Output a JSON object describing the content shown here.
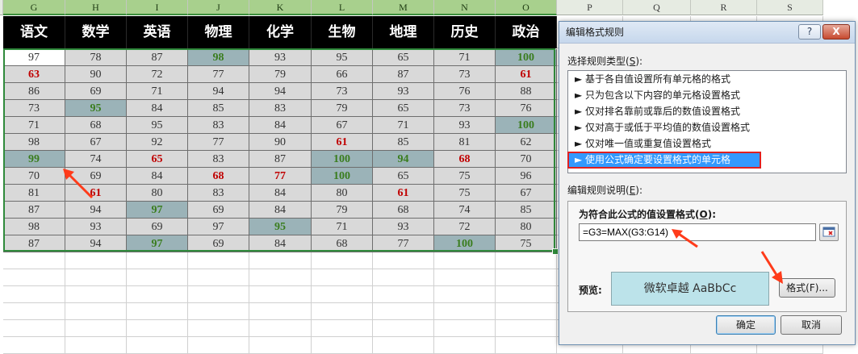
{
  "sheet": {
    "columns": [
      "G",
      "H",
      "I",
      "J",
      "K",
      "L",
      "M",
      "N",
      "O",
      "P",
      "Q",
      "R",
      "S"
    ],
    "headers": [
      "语文",
      "数学",
      "英语",
      "物理",
      "化学",
      "生物",
      "地理",
      "历史",
      "政治"
    ],
    "rows": [
      [
        97,
        78,
        87,
        98,
        93,
        95,
        65,
        71,
        100
      ],
      [
        63,
        90,
        72,
        77,
        79,
        66,
        87,
        73,
        61
      ],
      [
        86,
        69,
        71,
        94,
        94,
        73,
        93,
        76,
        88
      ],
      [
        73,
        95,
        84,
        85,
        83,
        79,
        65,
        73,
        76
      ],
      [
        71,
        68,
        95,
        83,
        84,
        67,
        71,
        93,
        100
      ],
      [
        98,
        67,
        92,
        77,
        90,
        61,
        85,
        81,
        62
      ],
      [
        99,
        74,
        65,
        83,
        87,
        100,
        94,
        68,
        70
      ],
      [
        70,
        69,
        84,
        68,
        77,
        100,
        65,
        75,
        96
      ],
      [
        81,
        61,
        80,
        83,
        84,
        80,
        61,
        75,
        67
      ],
      [
        87,
        94,
        97,
        69,
        84,
        79,
        68,
        74,
        85
      ],
      [
        98,
        93,
        69,
        97,
        95,
        71,
        93,
        72,
        80
      ],
      [
        87,
        94,
        97,
        69,
        84,
        68,
        77,
        100,
        75
      ]
    ]
  },
  "colors": {
    "max_fill": "#9bb3b8",
    "max_text": "#3a7d1e",
    "min_text": "#c00000",
    "selection_border": "#2f8a3b",
    "highlight_outline": "#e02020",
    "selected_rule_bg": "#3399ff"
  },
  "dialog": {
    "title": "编辑格式规则",
    "help_label": "?",
    "close_label": "X",
    "select_type_label": "选择规则类型(",
    "select_type_key": "S",
    "select_type_suffix": "):",
    "rule_types": [
      "基于各自值设置所有单元格的格式",
      "只为包含以下内容的单元格设置格式",
      "仅对排名靠前或靠后的数值设置格式",
      "仅对高于或低于平均值的数值设置格式",
      "仅对唯一值或重复值设置格式",
      "使用公式确定要设置格式的单元格"
    ],
    "rule_marker": "►",
    "selected_index": 5,
    "edit_desc_label": "编辑规则说明(",
    "edit_desc_key": "E",
    "edit_desc_suffix": "):",
    "formula_label": "为符合此公式的值设置格式(",
    "formula_key": "O",
    "formula_suffix": "):",
    "formula_value": "=G3=MAX(G3:G14)",
    "preview_label": "预览:",
    "preview_text": "微软卓越  AaBbCc",
    "format_button": "格式(F)...",
    "ok_button": "确定",
    "cancel_button": "取消"
  }
}
